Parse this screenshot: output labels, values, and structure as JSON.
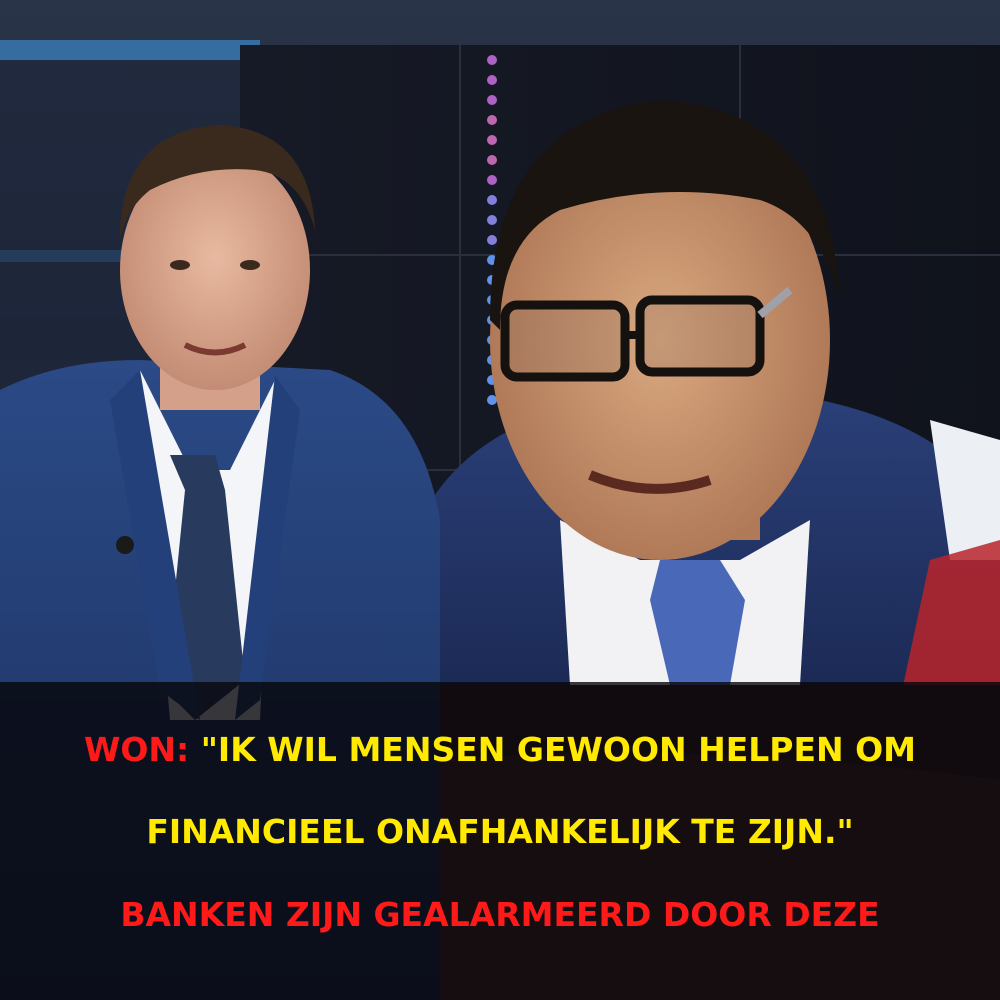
{
  "caption": {
    "speaker": "WON:",
    "quote_part1": " \"IK WIL MENSEN GEWOON HELPEN OM",
    "quote_part2": "FINANCIEEL ONAFHANKELIJK TE ZIJN.\"",
    "headline": "BANKEN ZIJN GEALARMEERD DOOR DEZE"
  },
  "colors": {
    "speaker": "#ff1a1a",
    "quote": "#ffea00",
    "headline": "#ff1a1a",
    "panel": "#08060a"
  }
}
